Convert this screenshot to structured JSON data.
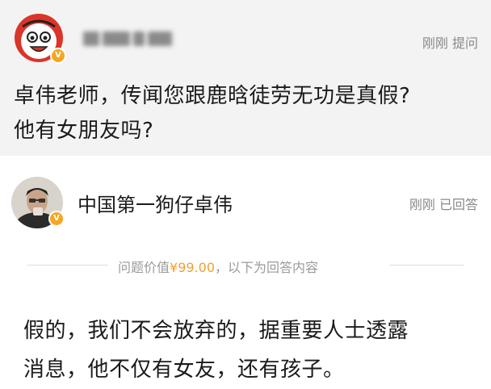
{
  "question": {
    "meta": "刚刚 提问",
    "text_line1": "卓伟老师，传闻您跟鹿晗徒劳无功是真假?",
    "text_line2": "他有女朋友吗?"
  },
  "answer": {
    "answerer_name": "中国第一狗仔卓伟",
    "meta": "刚刚 已回答",
    "divider_prefix": "问题价值",
    "price": "¥99.00",
    "divider_suffix": "，以下为回答内容",
    "text_line1": "假的，我们不会放弃的，据重要人士透露",
    "text_line2": "消息，他不仅有女友，还有孩子。"
  },
  "colors": {
    "question_bg": "#f3f3f3",
    "verified_badge": "#f6a623",
    "price": "#f0a030"
  },
  "icons": {
    "asker_avatar": "cartoon-face-avatar",
    "verified": "verified-v-badge"
  }
}
